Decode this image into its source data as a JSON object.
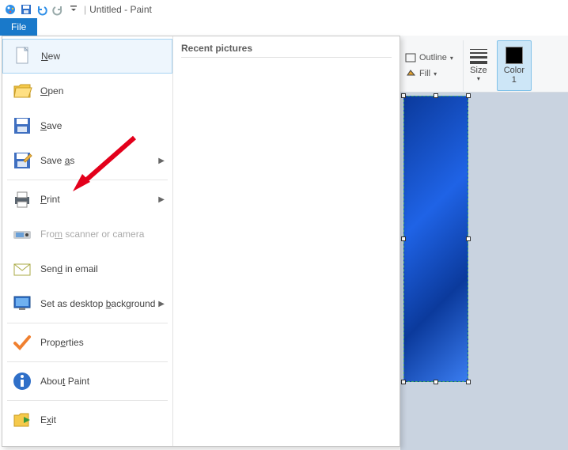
{
  "titlebar": {
    "document_name": "Untitled",
    "app_name": "Paint"
  },
  "tabs": {
    "file": "File"
  },
  "file_menu": {
    "items": [
      {
        "label": "New",
        "u": "N",
        "rest": "ew",
        "icon": "new-file-icon",
        "selected": true
      },
      {
        "label": "Open",
        "u": "O",
        "rest": "pen",
        "icon": "open-folder-icon"
      },
      {
        "label": "Save",
        "u": "S",
        "rest": "ave",
        "icon": "save-disk-icon"
      },
      {
        "label": "Save as",
        "u": "a",
        "pre": "Save ",
        "rest": "s",
        "icon": "save-as-icon",
        "submenu": true
      },
      {
        "sep": true
      },
      {
        "label": "Print",
        "u": "P",
        "rest": "rint",
        "icon": "printer-icon",
        "submenu": true
      },
      {
        "label": "From scanner or camera",
        "u": "m",
        "pre": "Fro",
        "rest": " scanner or camera",
        "icon": "scanner-icon",
        "disabled": true
      },
      {
        "label": "Send in email",
        "u": "d",
        "pre": "Sen",
        "rest": " in email",
        "icon": "email-icon"
      },
      {
        "label": "Set as desktop background",
        "u": "b",
        "pre": "Set as desktop ",
        "rest": "ackground",
        "icon": "desktop-icon",
        "submenu": true
      },
      {
        "sep": true
      },
      {
        "label": "Properties",
        "u": "e",
        "pre": "Prop",
        "rest": "rties",
        "icon": "check-icon"
      },
      {
        "sep": true
      },
      {
        "label": "About Paint",
        "u": "t",
        "pre": "Abou",
        "rest": " Paint",
        "icon": "info-icon"
      },
      {
        "sep": true
      },
      {
        "label": "Exit",
        "u": "x",
        "pre": "E",
        "rest": "it",
        "icon": "exit-icon"
      }
    ],
    "recent_header": "Recent pictures"
  },
  "ribbon": {
    "outline": "Outline",
    "fill": "Fill",
    "size": "Size",
    "color1": "Color\n1"
  }
}
